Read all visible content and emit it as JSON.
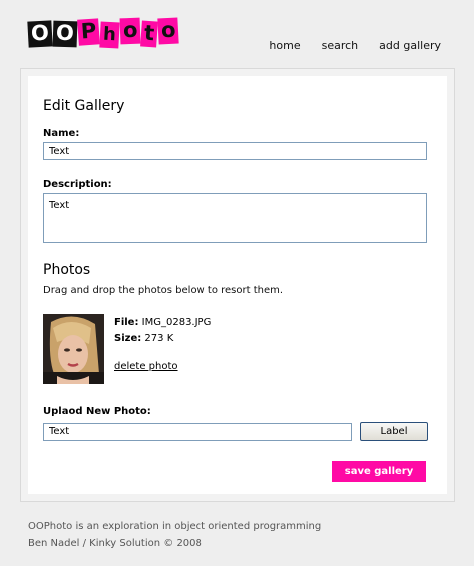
{
  "header": {
    "logo_letters": [
      "O",
      "O",
      "P",
      "h",
      "o",
      "t",
      "o"
    ],
    "logo_styles": [
      "dark",
      "dark",
      "pink",
      "pink",
      "pink",
      "pink",
      "pink"
    ],
    "nav": [
      "home",
      "search",
      "add gallery"
    ]
  },
  "form": {
    "title": "Edit Gallery",
    "name_label": "Name:",
    "name_value": "Text",
    "description_label": "Description:",
    "description_value": "Text",
    "photos_title": "Photos",
    "photos_hint": "Drag and drop the photos below to resort them.",
    "photo": {
      "file_label": "File:",
      "file_value": "IMG_0283.JPG",
      "size_label": "Size:",
      "size_value": "273 K",
      "delete_label": "delete photo"
    },
    "upload_label": "Uplaod New Photo:",
    "upload_value": "Text",
    "upload_button": "Label",
    "save_button": "save gallery"
  },
  "footer": {
    "line1": "OOPhoto is an exploration in object oriented programming",
    "line2": "Ben Nadel / Kinky Solution © 2008"
  },
  "colors": {
    "accent": "#ff0aa5",
    "logo_dark": "#111111",
    "input_border": "#7f9db9",
    "background": "#eeeeee"
  }
}
